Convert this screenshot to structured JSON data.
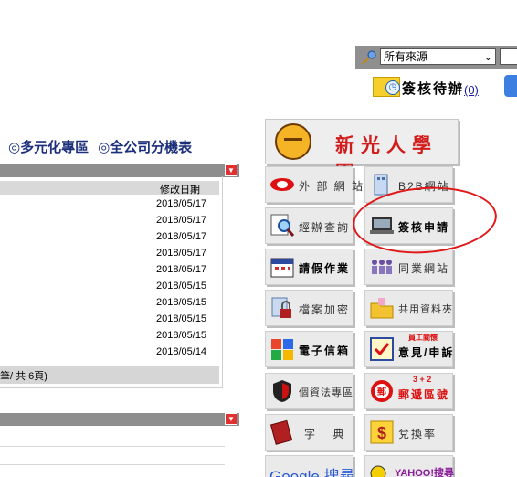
{
  "search": {
    "source_select": "所有來源"
  },
  "approvals": {
    "label": "簽核待辦",
    "count": "(0)"
  },
  "quick_links": [
    "◎多元化專區",
    "◎全公司分機表"
  ],
  "panel1": {
    "column_header": "修改日期",
    "dates": [
      "2018/05/17",
      "2018/05/17",
      "2018/05/17",
      "2018/05/17",
      "2018/05/17",
      "2018/05/15",
      "2018/05/15",
      "2018/05/15",
      "2018/05/15",
      "2018/05/14"
    ],
    "pager": "筆/ 共 6頁)"
  },
  "portal": {
    "title": "新光人學園",
    "tiles": [
      {
        "label": "外 部 網 站"
      },
      {
        "label": "B2B網站"
      },
      {
        "label": "經辦查詢"
      },
      {
        "label": "簽核申請"
      },
      {
        "label": "請假作業"
      },
      {
        "label": "同業網站"
      },
      {
        "label": "檔案加密"
      },
      {
        "label": "共用資料夾"
      },
      {
        "label": "電子信箱"
      },
      {
        "label": "意見/申訴",
        "badge": "員工關懷"
      },
      {
        "label": "個資法專區"
      },
      {
        "label": "郵遞區號",
        "badge": "3 + 2"
      },
      {
        "label": "字 典"
      },
      {
        "label": "兌換率"
      },
      {
        "label": "Google 搜尋"
      },
      {
        "label": "YAHOO!搜尋"
      }
    ]
  },
  "colors": {
    "accent_red": "#d21b1b",
    "link_blue": "#1c2f7a",
    "header_gray": "#8e8e8e"
  }
}
